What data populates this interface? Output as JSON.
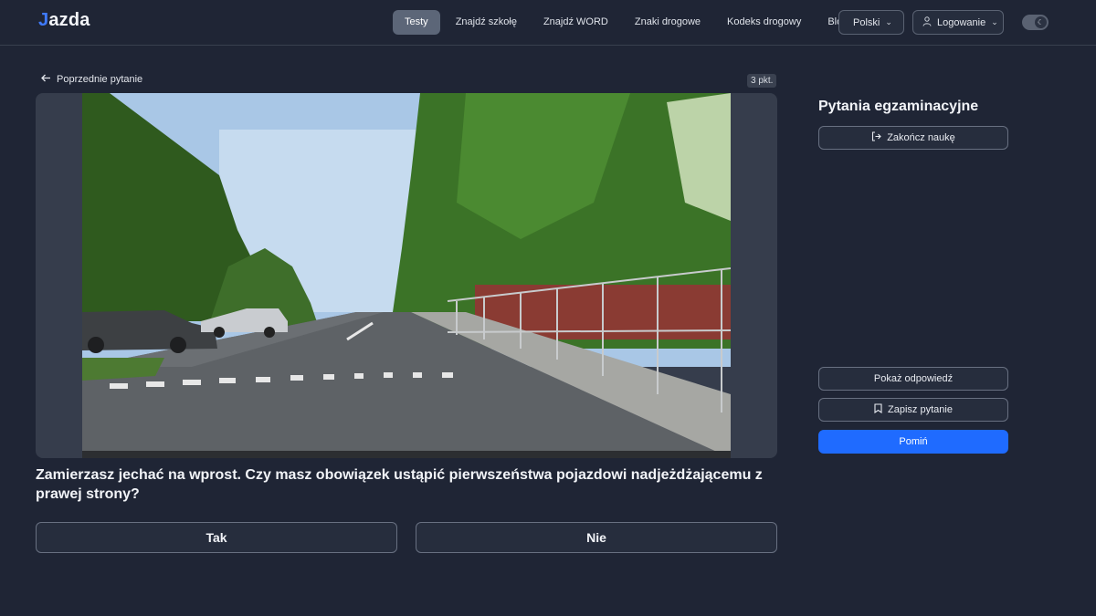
{
  "header": {
    "logo": "jazda",
    "logo_first": "J",
    "logo_rest": "azda",
    "nav": [
      "Testy",
      "Znajdź szkołę",
      "Znajdź WORD",
      "Znaki drogowe",
      "Kodeks drogowy",
      "Blog"
    ],
    "active_nav": "Testy",
    "language": "Polski",
    "login": "Logowanie"
  },
  "main": {
    "back_label": "Poprzednie pytanie",
    "points": "3 pkt.",
    "question": "Zamierzasz jechać na wprost. Czy masz obowiązek ustąpić pierwszeństwa pojazdowi nadjeżdżającemu z prawej strony?",
    "answers": [
      "Tak",
      "Nie"
    ]
  },
  "sidebar": {
    "title": "Pytania egzaminacyjne",
    "finish_label": "Zakończ naukę",
    "show_answer_label": "Pokaż odpowiedź",
    "save_label": "Zapisz pytanie",
    "skip_label": "Pomiń"
  },
  "colors": {
    "background": "#1f2535",
    "accent": "#1f6bff",
    "logo_accent": "#3f7bff"
  },
  "icons": {
    "back": "arrow-left-icon",
    "chevron": "chevron-down-icon",
    "user": "user-icon",
    "theme": "moon-icon",
    "finish": "logout-icon",
    "save": "bookmark-icon"
  }
}
